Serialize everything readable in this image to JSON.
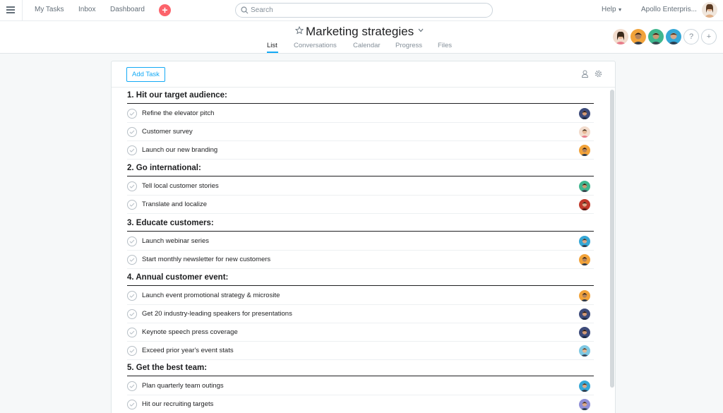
{
  "topbar": {
    "nav": [
      "My Tasks",
      "Inbox",
      "Dashboard"
    ],
    "search_placeholder": "Search",
    "help": "Help",
    "org": "Apollo Enterpris..."
  },
  "project": {
    "title": "Marketing strategies",
    "tabs": [
      "List",
      "Conversations",
      "Calendar",
      "Progress",
      "Files"
    ],
    "active_tab": "List",
    "member_buttons": [
      "?",
      "+"
    ]
  },
  "toolbar": {
    "add_task": "Add Task"
  },
  "sections": [
    {
      "title": "1. Hit our target audience:",
      "tasks": [
        {
          "name": "Refine the elevator pitch",
          "avatar": "navy"
        },
        {
          "name": "Customer survey",
          "avatar": "woman"
        },
        {
          "name": "Launch our new branding",
          "avatar": "orange"
        }
      ]
    },
    {
      "title": "2. Go international:",
      "tasks": [
        {
          "name": "Tell local customer stories",
          "avatar": "teal"
        },
        {
          "name": "Translate and localize",
          "avatar": "red"
        }
      ]
    },
    {
      "title": "3. Educate customers:",
      "tasks": [
        {
          "name": "Launch webinar series",
          "avatar": "blue"
        },
        {
          "name": "Start monthly newsletter for new customers",
          "avatar": "orange"
        }
      ]
    },
    {
      "title": "4. Annual customer event:",
      "tasks": [
        {
          "name": "Launch event promotional strategy & microsite",
          "avatar": "orange"
        },
        {
          "name": "Get 20 industry-leading speakers for presentations",
          "avatar": "navy"
        },
        {
          "name": "Keynote speech press coverage",
          "avatar": "navy"
        },
        {
          "name": "Exceed prior year's event stats",
          "avatar": "lightblue"
        }
      ]
    },
    {
      "title": "5. Get the best team:",
      "tasks": [
        {
          "name": "Plan quarterly team outings",
          "avatar": "blue"
        },
        {
          "name": "Hit our recruiting targets",
          "avatar": "lavender"
        }
      ]
    }
  ],
  "colors": {
    "accent": "#14aaf5",
    "add_button": "#fc636b",
    "avatar_navy": "#3d4b7a",
    "avatar_woman": "#f2dccd",
    "avatar_orange": "#f2a33a",
    "avatar_teal": "#3fb68e",
    "avatar_red": "#c0392b",
    "avatar_blue": "#35a7d6",
    "avatar_lightblue": "#7ec8e3",
    "avatar_lavender": "#8e8ed6"
  }
}
